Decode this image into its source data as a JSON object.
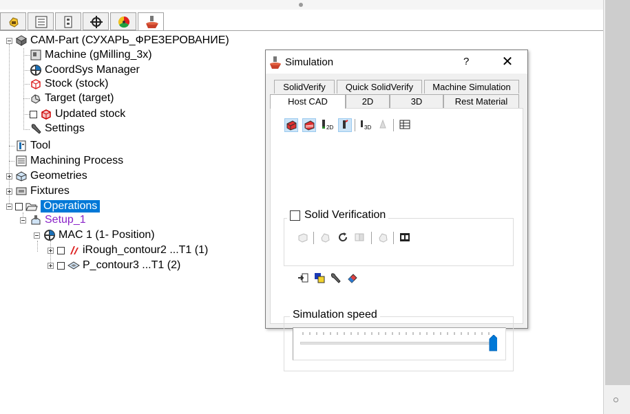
{
  "tree": {
    "root_label": "CAM-Part (СУХАРЬ_ФРЕЗЕРОВАНИЕ)",
    "machine_label": "Machine (gMilling_3x)",
    "coordsys_label": "CoordSys Manager",
    "stock_label": "Stock (stock)",
    "target_label": "Target (target)",
    "updated_stock_label": "Updated stock",
    "settings_label": "Settings",
    "tool_label": "Tool",
    "machining_process_label": "Machining Process",
    "geometries_label": "Geometries",
    "fixtures_label": "Fixtures",
    "operations_label": "Operations",
    "setup_label": "Setup_1",
    "mac_label": "MAC 1 (1- Position)",
    "op1_label": "iRough_contour2 ...T1 (1)",
    "op2_label": "P_contour3 ...T1 (2)"
  },
  "dialog": {
    "title": "Simulation",
    "help": "?",
    "close": "✕",
    "tabs_top": [
      "SolidVerify",
      "Quick SolidVerify",
      "Machine Simulation"
    ],
    "tabs_bottom": [
      "Host CAD",
      "2D",
      "3D",
      "Rest Material"
    ],
    "active_tab": "Host CAD",
    "solid_verification_label": "Solid Verification",
    "solid_verification_checked": false,
    "simulation_speed_label": "Simulation speed",
    "simulation_speed_fraction": 1.0
  },
  "colors": {
    "selection": "#0078d7",
    "setup_text": "#8a22c8",
    "slider_thumb": "#0078d7"
  },
  "icons": [
    "hand-icon",
    "list-icon",
    "tree-icon",
    "crosshair-icon",
    "color-wheel-icon",
    "simulation-icon"
  ]
}
